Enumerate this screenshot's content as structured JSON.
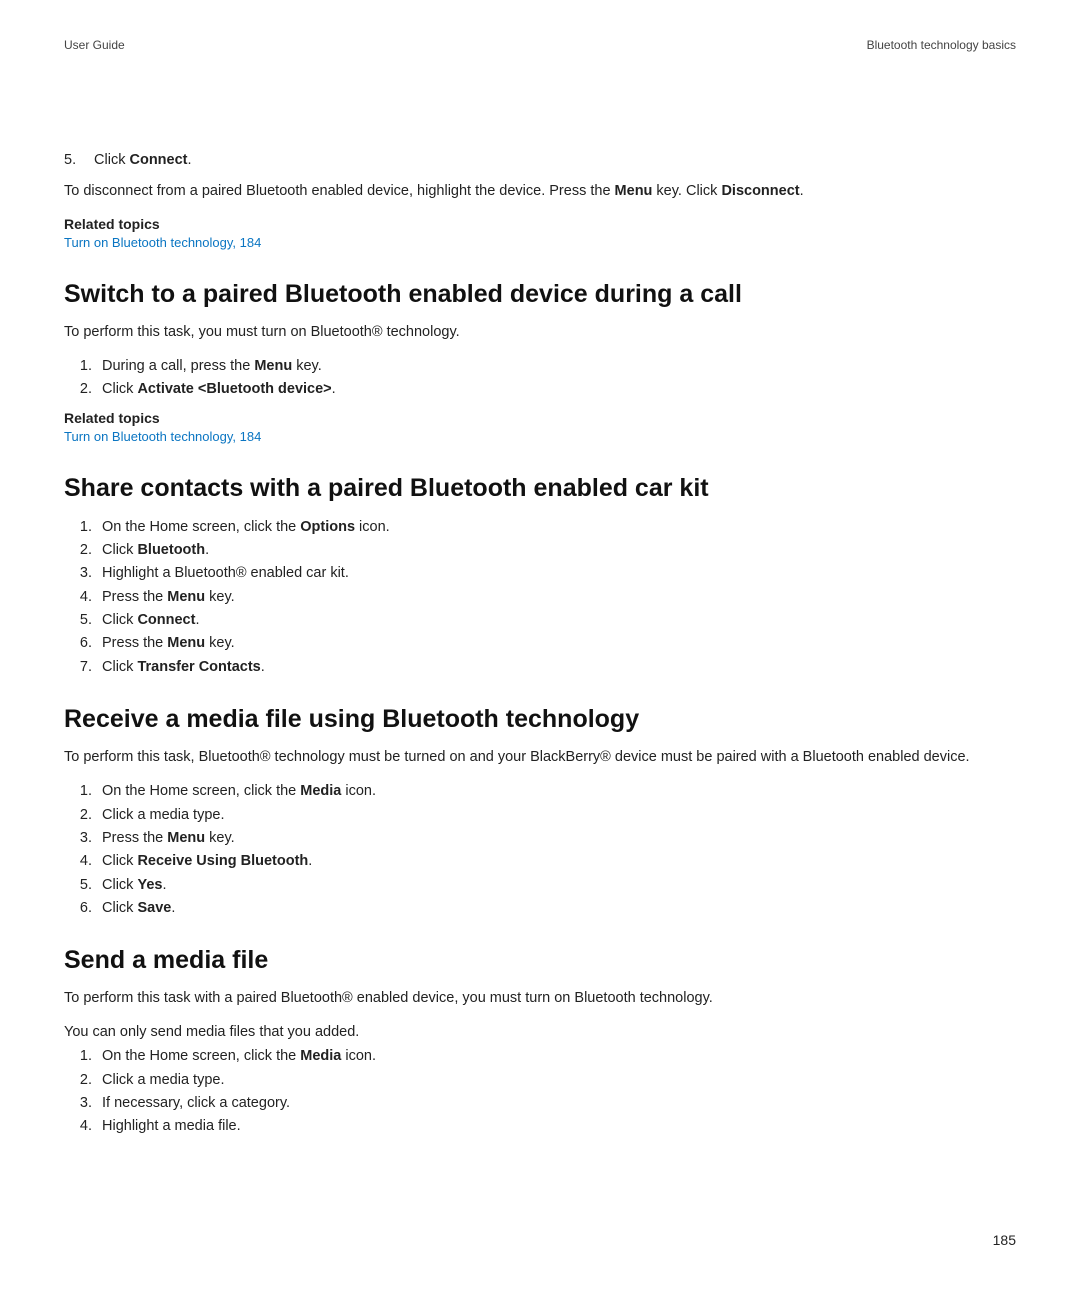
{
  "header": {
    "left": "User Guide",
    "right": "Bluetooth technology basics"
  },
  "intro": {
    "step5_num": "5.",
    "step5_pre": "Click ",
    "step5_b": "Connect",
    "step5_post": ".",
    "disc_pre": "To disconnect from a paired Bluetooth enabled device, highlight the device. Press the ",
    "disc_b1": "Menu",
    "disc_mid": " key. Click ",
    "disc_b2": "Disconnect",
    "disc_post": ".",
    "related_heading": "Related topics",
    "related_link": "Turn on Bluetooth technology, 184"
  },
  "sect1": {
    "title": "Switch to a paired Bluetooth enabled device during a call",
    "intro": "To perform this task, you must turn on Bluetooth® technology.",
    "s1_pre": "During a call, press the ",
    "s1_b": "Menu",
    "s1_post": " key.",
    "s2_pre": "Click ",
    "s2_b": "Activate <Bluetooth device>",
    "s2_post": ".",
    "related_heading": "Related topics",
    "related_link": "Turn on Bluetooth technology, 184"
  },
  "sect2": {
    "title": "Share contacts with a paired Bluetooth enabled car kit",
    "s1_pre": "On the Home screen, click the ",
    "s1_b": "Options",
    "s1_post": " icon.",
    "s2_pre": "Click ",
    "s2_b": "Bluetooth",
    "s2_post": ".",
    "s3": "Highlight a Bluetooth® enabled car kit.",
    "s4_pre": "Press the ",
    "s4_b": "Menu",
    "s4_post": " key.",
    "s5_pre": "Click ",
    "s5_b": "Connect",
    "s5_post": ".",
    "s6_pre": "Press the ",
    "s6_b": "Menu",
    "s6_post": " key.",
    "s7_pre": "Click ",
    "s7_b": "Transfer Contacts",
    "s7_post": "."
  },
  "sect3": {
    "title": "Receive a media file using Bluetooth technology",
    "intro": "To perform this task, Bluetooth® technology must be turned on and your BlackBerry® device must be paired with a Bluetooth enabled device.",
    "s1_pre": "On the Home screen, click the ",
    "s1_b": "Media",
    "s1_post": " icon.",
    "s2": "Click a media type.",
    "s3_pre": "Press the ",
    "s3_b": "Menu",
    "s3_post": " key.",
    "s4_pre": "Click ",
    "s4_b": "Receive Using Bluetooth",
    "s4_post": ".",
    "s5_pre": "Click ",
    "s5_b": "Yes",
    "s5_post": ".",
    "s6_pre": "Click ",
    "s6_b": "Save",
    "s6_post": "."
  },
  "sect4": {
    "title": "Send a media file",
    "intro": "To perform this task with a paired Bluetooth® enabled device, you must turn on Bluetooth technology.",
    "note": "You can only send media files that you added.",
    "s1_pre": "On the Home screen, click the ",
    "s1_b": "Media",
    "s1_post": " icon.",
    "s2": "Click a media type.",
    "s3": "If necessary, click a category.",
    "s4": "Highlight a media file."
  },
  "page_number": "185"
}
